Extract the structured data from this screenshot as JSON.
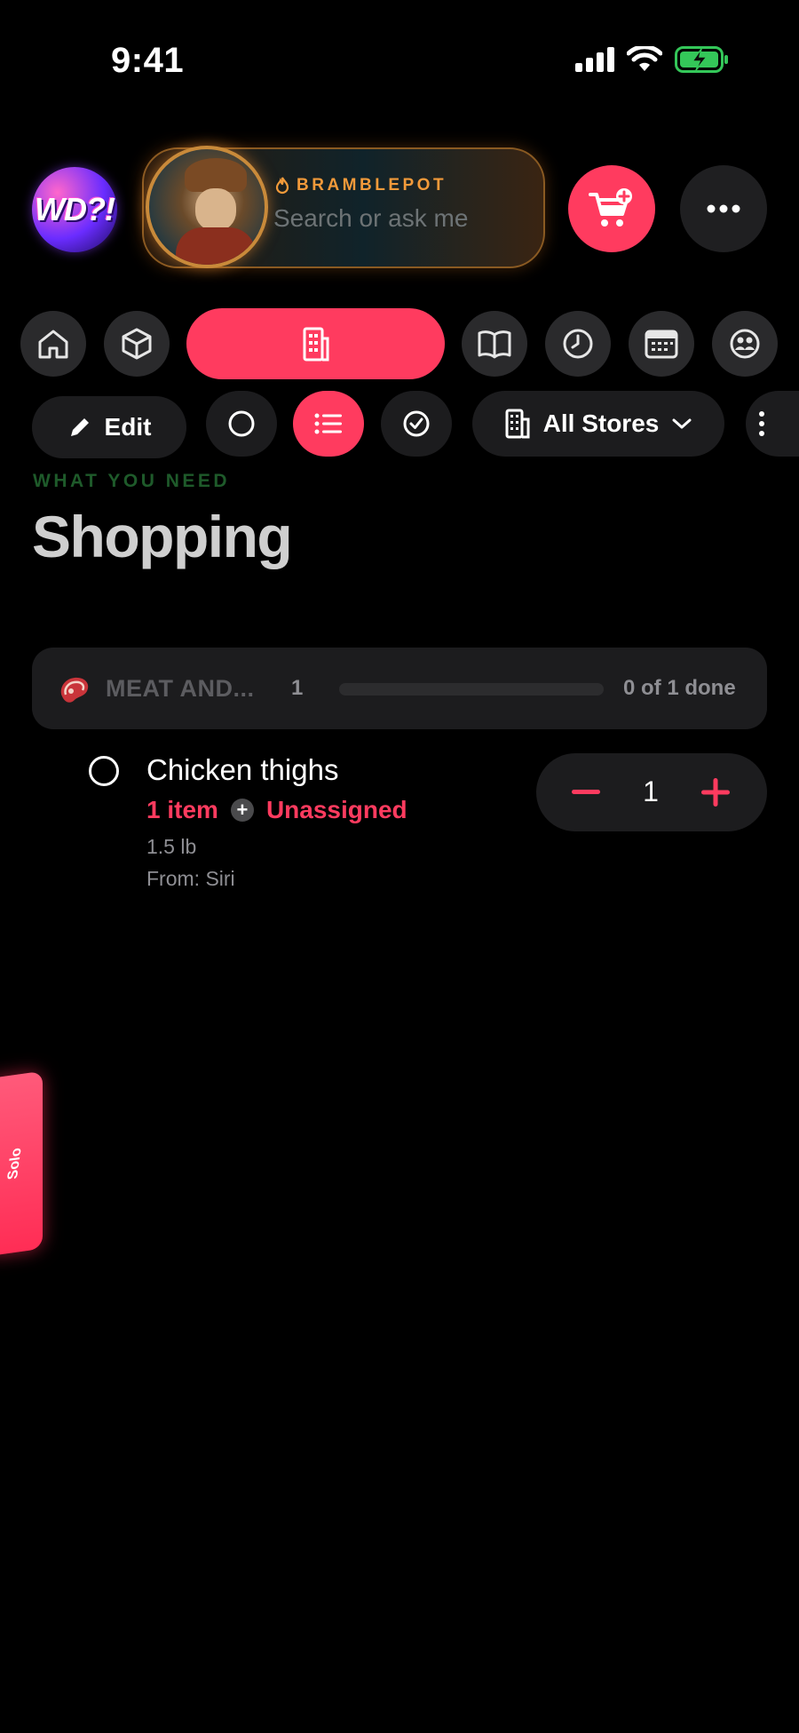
{
  "status_bar": {
    "time": "9:41",
    "icons": [
      "cellular-signal-icon",
      "wifi-icon",
      "battery-charging-icon"
    ]
  },
  "header": {
    "logo_text": "WD?!",
    "assistant_name": "BRAMBLEPOT",
    "search_placeholder": "Search or ask me",
    "cart_icon": "cart-plus-icon",
    "more_icon": "ellipsis-icon"
  },
  "nav": {
    "items": [
      {
        "icon": "home-icon",
        "active": false
      },
      {
        "icon": "package-icon",
        "active": false
      },
      {
        "icon": "building-icon",
        "active": true
      },
      {
        "icon": "book-icon",
        "active": false
      },
      {
        "icon": "clock-icon",
        "active": false
      },
      {
        "icon": "calendar-icon",
        "active": false
      },
      {
        "icon": "family-icon",
        "active": false
      }
    ]
  },
  "toolbar": {
    "edit_label": "Edit",
    "filter_icons": [
      "circle-icon",
      "list-icon",
      "check-circle-icon"
    ],
    "active_filter": "list-icon",
    "store_label": "All Stores"
  },
  "page": {
    "eyebrow": "WHAT YOU NEED",
    "title": "Shopping"
  },
  "colors": {
    "accent": "#ff3b5f",
    "eyebrow": "#1e5a2a",
    "assistant": "#f29a3a",
    "surface": "#1c1c1e"
  },
  "category": {
    "icon": "steak-icon",
    "name": "MEAT AND...",
    "count": "1",
    "progress": 0,
    "done_label": "0 of 1 done"
  },
  "items": [
    {
      "title": "Chicken thighs",
      "count_label": "1 item",
      "assignee": "Unassigned",
      "weight": "1.5 lb",
      "source": "From: Siri",
      "quantity": "1",
      "checked": false
    }
  ],
  "side_tab": {
    "label": "Solo"
  }
}
